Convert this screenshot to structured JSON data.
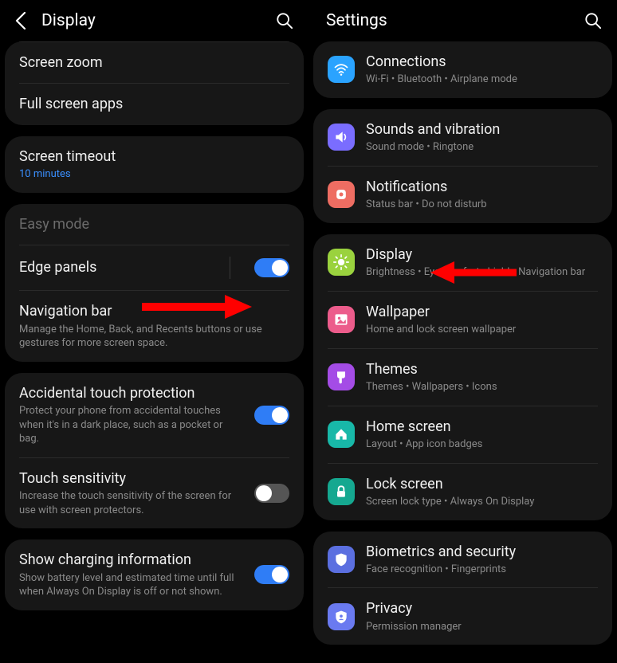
{
  "left": {
    "title": "Display",
    "sections": [
      {
        "rows": [
          {
            "title": "Screen zoom"
          },
          {
            "title": "Full screen apps"
          }
        ]
      },
      {
        "rows": [
          {
            "title": "Screen timeout",
            "sub": "10 minutes",
            "subBlue": true
          }
        ]
      },
      {
        "rows": [
          {
            "title": "Easy mode",
            "muted": true
          },
          {
            "title": "Edge panels",
            "toggle": "on",
            "vbar": true
          },
          {
            "title": "Navigation bar",
            "sub": "Manage the Home, Back, and Recents buttons or use gestures for more screen space."
          }
        ]
      },
      {
        "rows": [
          {
            "title": "Accidental touch protection",
            "sub": "Protect your phone from accidental touches when it's in a dark place, such as a pocket or bag.",
            "toggle": "on"
          },
          {
            "title": "Touch sensitivity",
            "sub": "Increase the touch sensitivity of the screen for use with screen protectors.",
            "toggle": "off"
          }
        ]
      },
      {
        "rows": [
          {
            "title": "Show charging information",
            "sub": "Show battery level and estimated time until full when Always On Display is off or not shown.",
            "toggle": "on"
          }
        ]
      }
    ]
  },
  "right": {
    "title": "Settings",
    "sections": [
      {
        "rows": [
          {
            "icon": "wifi",
            "tile": "blue-t",
            "title": "Connections",
            "sub": "Wi-Fi  •  Bluetooth  •  Airplane mode"
          }
        ]
      },
      {
        "rows": [
          {
            "icon": "sound",
            "tile": "purple-t",
            "title": "Sounds and vibration",
            "sub": "Sound mode  •  Ringtone"
          },
          {
            "icon": "bell",
            "tile": "coral-t",
            "title": "Notifications",
            "sub": "Status bar  •  Do not disturb"
          }
        ]
      },
      {
        "rows": [
          {
            "icon": "sun",
            "tile": "green-t",
            "title": "Display",
            "sub": "Brightness  •  Eye comfort shield  •  Navigation bar"
          },
          {
            "icon": "image",
            "tile": "pink-t",
            "title": "Wallpaper",
            "sub": "Home and lock screen wallpaper"
          },
          {
            "icon": "brush",
            "tile": "violet-t",
            "title": "Themes",
            "sub": "Themes  •  Wallpapers  •  Icons"
          },
          {
            "icon": "home",
            "tile": "teal-t",
            "title": "Home screen",
            "sub": "Layout  •  App icon badges"
          },
          {
            "icon": "lock",
            "tile": "teal2-t",
            "title": "Lock screen",
            "sub": "Screen lock type  •  Always On Display"
          }
        ]
      },
      {
        "rows": [
          {
            "icon": "shield",
            "tile": "indigo-t",
            "title": "Biometrics and security",
            "sub": "Face recognition  •  Fingerprints"
          },
          {
            "icon": "shield2",
            "tile": "indigo2-t",
            "title": "Privacy",
            "sub": "Permission manager"
          }
        ]
      }
    ]
  },
  "annotations": {
    "arrow_color": "#ff0000"
  }
}
